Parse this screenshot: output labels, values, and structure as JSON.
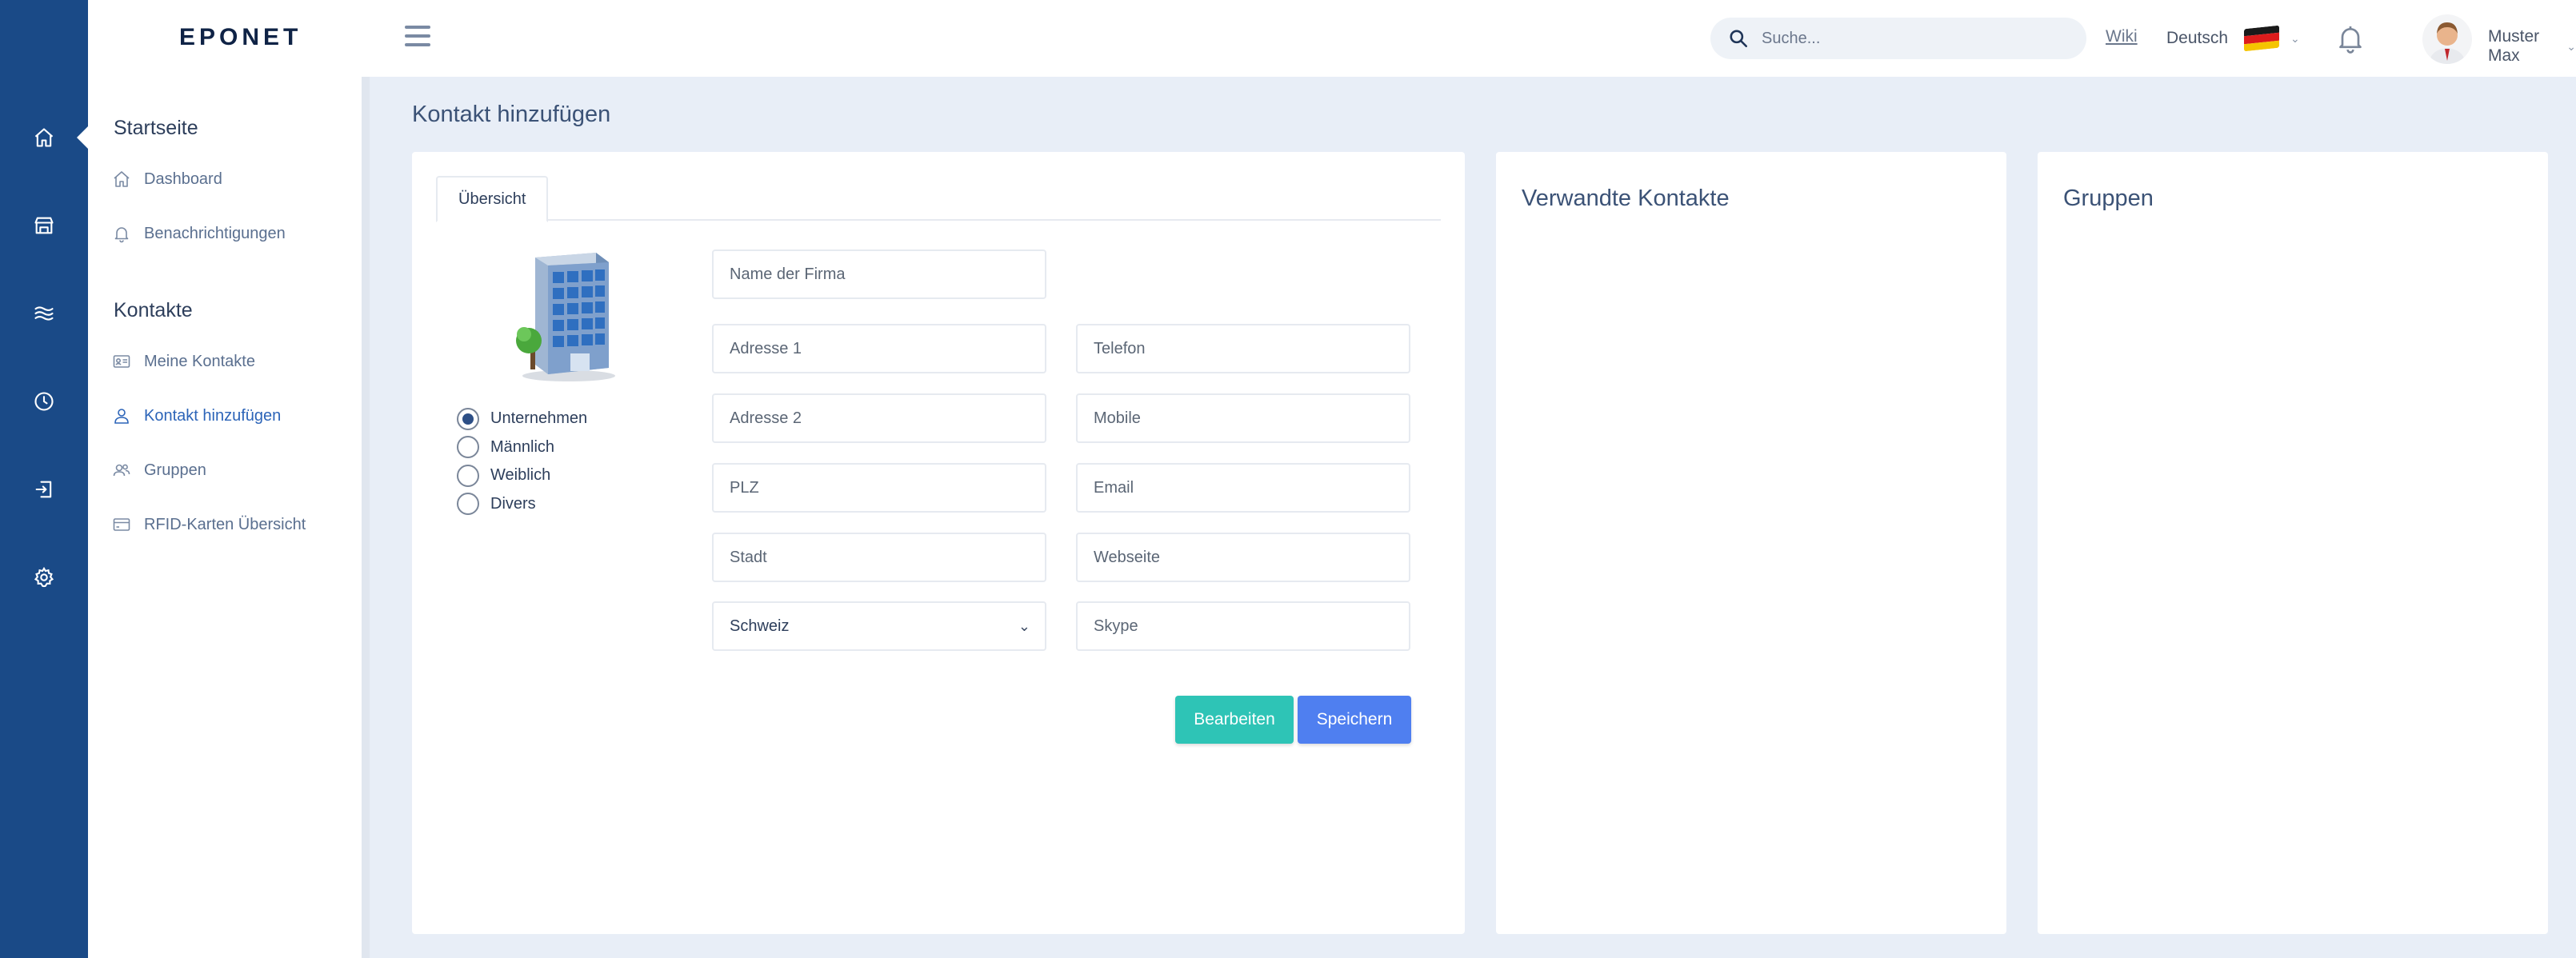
{
  "colors": {
    "rail_bg": "#1a4a87",
    "active_link": "#2c64b8",
    "button_edit": "#2ec4b6",
    "button_save": "#4f7ff0",
    "page_bg": "#e8eef7"
  },
  "header": {
    "logo": "EPONET",
    "search_placeholder": "Suche...",
    "wiki": "Wiki",
    "language": "Deutsch",
    "user_name": "Muster Max"
  },
  "rail": {
    "icons": [
      "home-icon",
      "store-icon",
      "waves-icon",
      "clock-icon",
      "login-icon",
      "settings-icon"
    ]
  },
  "sidenav": {
    "section_start": "Startseite",
    "dashboard": "Dashboard",
    "notifications": "Benachrichtigungen",
    "section_contacts": "Kontakte",
    "my_contacts": "Meine Kontakte",
    "add_contact": "Kontakt hinzufügen",
    "groups": "Gruppen",
    "rfid": "RFID-Karten Übersicht"
  },
  "page": {
    "title": "Kontakt hinzufügen"
  },
  "form": {
    "tab": "Übersicht",
    "radio_options": [
      "Unternehmen",
      "Männlich",
      "Weiblich",
      "Divers"
    ],
    "radio_selected": "Unternehmen",
    "company_placeholder": "Name der Firma",
    "address1_placeholder": "Adresse 1",
    "address2_placeholder": "Adresse 2",
    "zip_placeholder": "PLZ",
    "city_placeholder": "Stadt",
    "country": "Schweiz",
    "phone_placeholder": "Telefon",
    "mobile_placeholder": "Mobile",
    "email_placeholder": "Email",
    "website_placeholder": "Webseite",
    "skype_placeholder": "Skype",
    "edit_button": "Bearbeiten",
    "save_button": "Speichern"
  },
  "panels": {
    "related": "Verwandte Kontakte",
    "groups": "Gruppen"
  }
}
